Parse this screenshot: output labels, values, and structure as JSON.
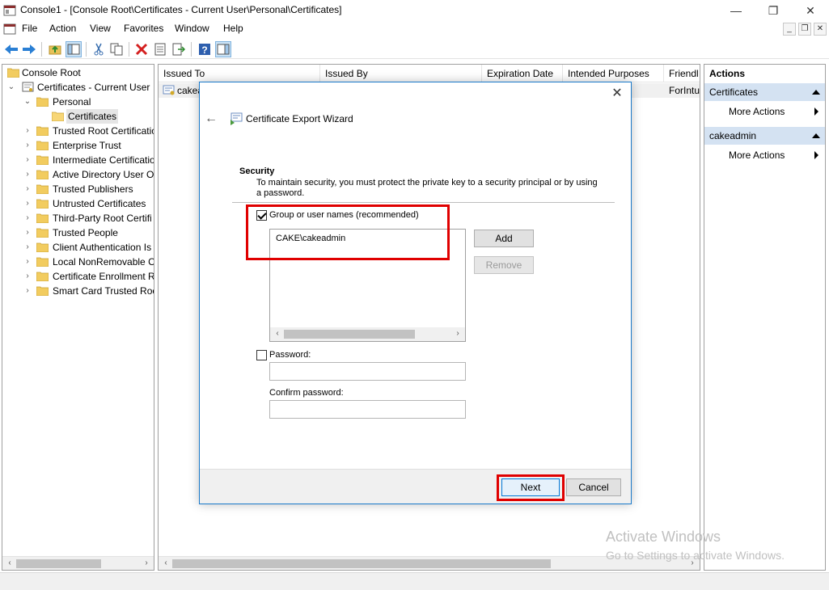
{
  "window": {
    "title": "Console1 - [Console Root\\Certificates - Current User\\Personal\\Certificates]",
    "minimize_glyph": "—",
    "maximize_glyph": "❐",
    "close_glyph": "✕"
  },
  "menu": {
    "items": [
      "File",
      "Action",
      "View",
      "Favorites",
      "Window",
      "Help"
    ],
    "mdi_min": "_",
    "mdi_restore": "❐",
    "mdi_close": "✕"
  },
  "toolbar": {
    "icons": [
      "back-icon",
      "forward-icon",
      "up-folder-icon",
      "show-hide-tree-icon",
      "cut-icon",
      "copy-icon",
      "delete-icon",
      "properties-icon",
      "export-list-icon",
      "help-icon",
      "show-hide-action-pane-icon"
    ]
  },
  "tree": {
    "items": [
      {
        "label": "Console Root",
        "level": 0,
        "expander": ""
      },
      {
        "label": "Certificates - Current User",
        "level": 1,
        "expander": "v"
      },
      {
        "label": "Personal",
        "level": 2,
        "expander": "v"
      },
      {
        "label": "Certificates",
        "level": 3,
        "expander": "",
        "selected": true
      },
      {
        "label": "Trusted Root Certification",
        "level": 2,
        "expander": ">"
      },
      {
        "label": "Enterprise Trust",
        "level": 2,
        "expander": ">"
      },
      {
        "label": "Intermediate Certification",
        "level": 2,
        "expander": ">"
      },
      {
        "label": "Active Directory User Ol",
        "level": 2,
        "expander": ">"
      },
      {
        "label": "Trusted Publishers",
        "level": 2,
        "expander": ">"
      },
      {
        "label": "Untrusted Certificates",
        "level": 2,
        "expander": ">"
      },
      {
        "label": "Third-Party Root Certifi",
        "level": 2,
        "expander": ">"
      },
      {
        "label": "Trusted People",
        "level": 2,
        "expander": ">"
      },
      {
        "label": "Client Authentication Is",
        "level": 2,
        "expander": ">"
      },
      {
        "label": "Local NonRemovable C",
        "level": 2,
        "expander": ">"
      },
      {
        "label": "Certificate Enrollment R",
        "level": 2,
        "expander": ">"
      },
      {
        "label": "Smart Card Trusted Roo",
        "level": 2,
        "expander": ">"
      }
    ]
  },
  "list": {
    "columns": [
      "Issued To",
      "Issued By",
      "Expiration Date",
      "Intended Purposes",
      "Friendl"
    ],
    "rows": [
      {
        "issued_to": "cakea",
        "friendly": "ForIntu"
      }
    ]
  },
  "actions": {
    "title": "Actions",
    "sections": [
      {
        "header": "Certificates",
        "item": "More Actions"
      },
      {
        "header": "cakeadmin",
        "item": "More Actions"
      }
    ]
  },
  "dialog": {
    "title": "Certificate Export Wizard",
    "close_glyph": "✕",
    "back_glyph": "←",
    "section_title": "Security",
    "section_desc": "To maintain security, you must protect the private key to a security principal or by using a password.",
    "group_checkbox_label": "Group or user names (recommended)",
    "group_checked": true,
    "principals": [
      "CAKE\\cakeadmin"
    ],
    "add_label": "Add",
    "remove_label": "Remove",
    "password_checkbox_label": "Password:",
    "password_checked": false,
    "password_value": "",
    "confirm_label": "Confirm password:",
    "confirm_value": "",
    "next_label": "Next",
    "cancel_label": "Cancel"
  },
  "watermark": {
    "line1": "Activate Windows",
    "line2": "Go to Settings to activate Windows."
  },
  "colors": {
    "highlight": "#e00000",
    "accent": "#1979ca",
    "action_header_bg": "#d4e2f2"
  }
}
